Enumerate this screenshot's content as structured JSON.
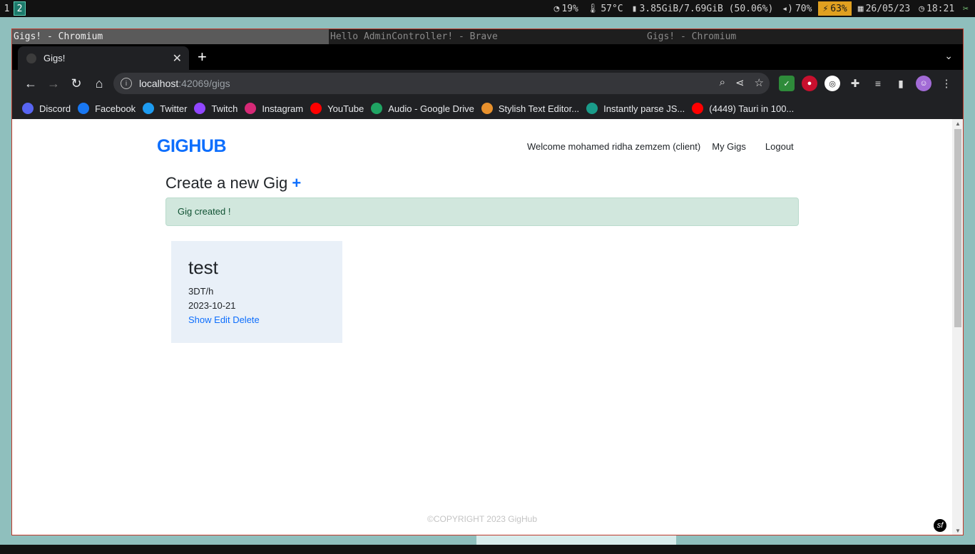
{
  "statusbar": {
    "workspaces": [
      "1",
      "2"
    ],
    "cpu": "19%",
    "temp": "57°C",
    "memory": "3.85GiB/7.69GiB (50.06%)",
    "volume": "70%",
    "battery": "63%",
    "date": "26/05/23",
    "time": "18:21"
  },
  "window_titles": [
    "Gigs! - Chromium",
    "Hello AdminController! - Brave",
    "Gigs! - Chromium"
  ],
  "tab": {
    "title": "Gigs!",
    "close": "✕"
  },
  "url": {
    "host": "localhost",
    "path": ":42069/gigs"
  },
  "bookmarks": [
    {
      "label": "Discord",
      "icon": "discord-icon",
      "color": "#5865f2"
    },
    {
      "label": "Facebook",
      "icon": "facebook-icon",
      "color": "#1877f2"
    },
    {
      "label": "Twitter",
      "icon": "twitter-icon",
      "color": "#1d9bf0"
    },
    {
      "label": "Twitch",
      "icon": "twitch-icon",
      "color": "#9146ff"
    },
    {
      "label": "Instagram",
      "icon": "instagram-icon",
      "color": "#d62976"
    },
    {
      "label": "YouTube",
      "icon": "youtube-icon",
      "color": "#ff0000"
    },
    {
      "label": "Audio - Google Drive",
      "icon": "google-drive-icon",
      "color": "#1fa463"
    },
    {
      "label": "Stylish Text Editor...",
      "icon": "stylish-icon",
      "color": "#e8912d"
    },
    {
      "label": "Instantly parse JS...",
      "icon": "quicktype-icon",
      "color": "#1a9c8a"
    },
    {
      "label": "(4449) Tauri in 100...",
      "icon": "youtube-icon",
      "color": "#ff0000"
    }
  ],
  "page": {
    "brand": "GIGHUB",
    "welcome": "Welcome mohamed ridha zemzem (client)",
    "nav_my_gigs": "My Gigs",
    "nav_logout": "Logout",
    "heading": "Create a new Gig",
    "heading_plus": "+",
    "alert": "Gig created !",
    "gig": {
      "title": "test",
      "price": "3DT/h",
      "date": "2023-10-21",
      "show": "Show",
      "edit": "Edit",
      "delete": "Delete"
    },
    "footer": "©COPYRIGHT 2023 GigHub"
  },
  "colors": {
    "brand": "#0d6efd",
    "alert_bg": "#d1e7dd",
    "card_bg": "#e9f0f8"
  }
}
